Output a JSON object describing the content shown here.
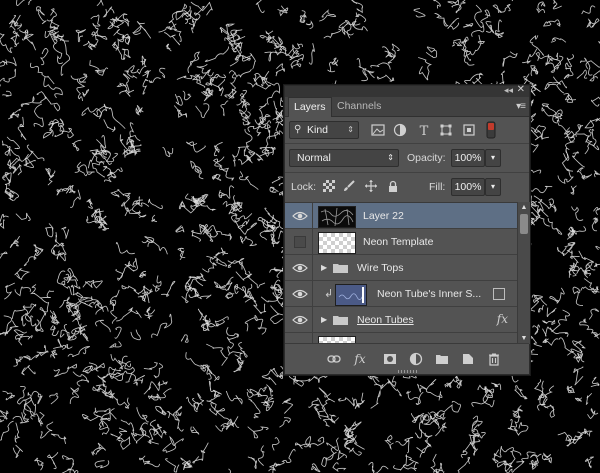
{
  "panel": {
    "tabs": [
      {
        "label": "Layers",
        "active": true
      },
      {
        "label": "Channels",
        "active": false
      }
    ],
    "filter": {
      "kind_label": "Kind"
    },
    "blend_mode": "Normal",
    "opacity_label": "Opacity:",
    "opacity_value": "100%",
    "lock_label": "Lock:",
    "fill_label": "Fill:",
    "fill_value": "100%",
    "layers": [
      {
        "name": "Layer 22",
        "selected": true,
        "visible": true
      },
      {
        "name": "Neon Template",
        "selected": false,
        "visible": false
      },
      {
        "name": "Wire Tops",
        "selected": false,
        "visible": true,
        "type": "group"
      },
      {
        "name": "Neon Tube's Inner S...",
        "selected": false,
        "visible": true,
        "clipped": true
      },
      {
        "name": "Neon Tubes",
        "selected": false,
        "visible": true,
        "type": "group",
        "has_fx": true
      }
    ],
    "fx_symbol": "fx"
  },
  "colors": {
    "canvas_bg": "#000000",
    "panel_bg": "#535353",
    "selected_row": "#5e6f85"
  },
  "icons": [
    "search-icon",
    "image-filter-icon",
    "adjustment-filter-icon",
    "type-filter-icon",
    "shape-filter-icon",
    "smart-object-filter-icon",
    "filter-toggle-icon",
    "lock-transparent-icon",
    "lock-paint-icon",
    "lock-position-icon",
    "lock-all-icon",
    "eye-icon",
    "folder-icon",
    "link-icon",
    "add-style-icon",
    "add-mask-icon",
    "new-adjustment-icon",
    "new-group-icon",
    "new-layer-icon",
    "trash-icon"
  ]
}
